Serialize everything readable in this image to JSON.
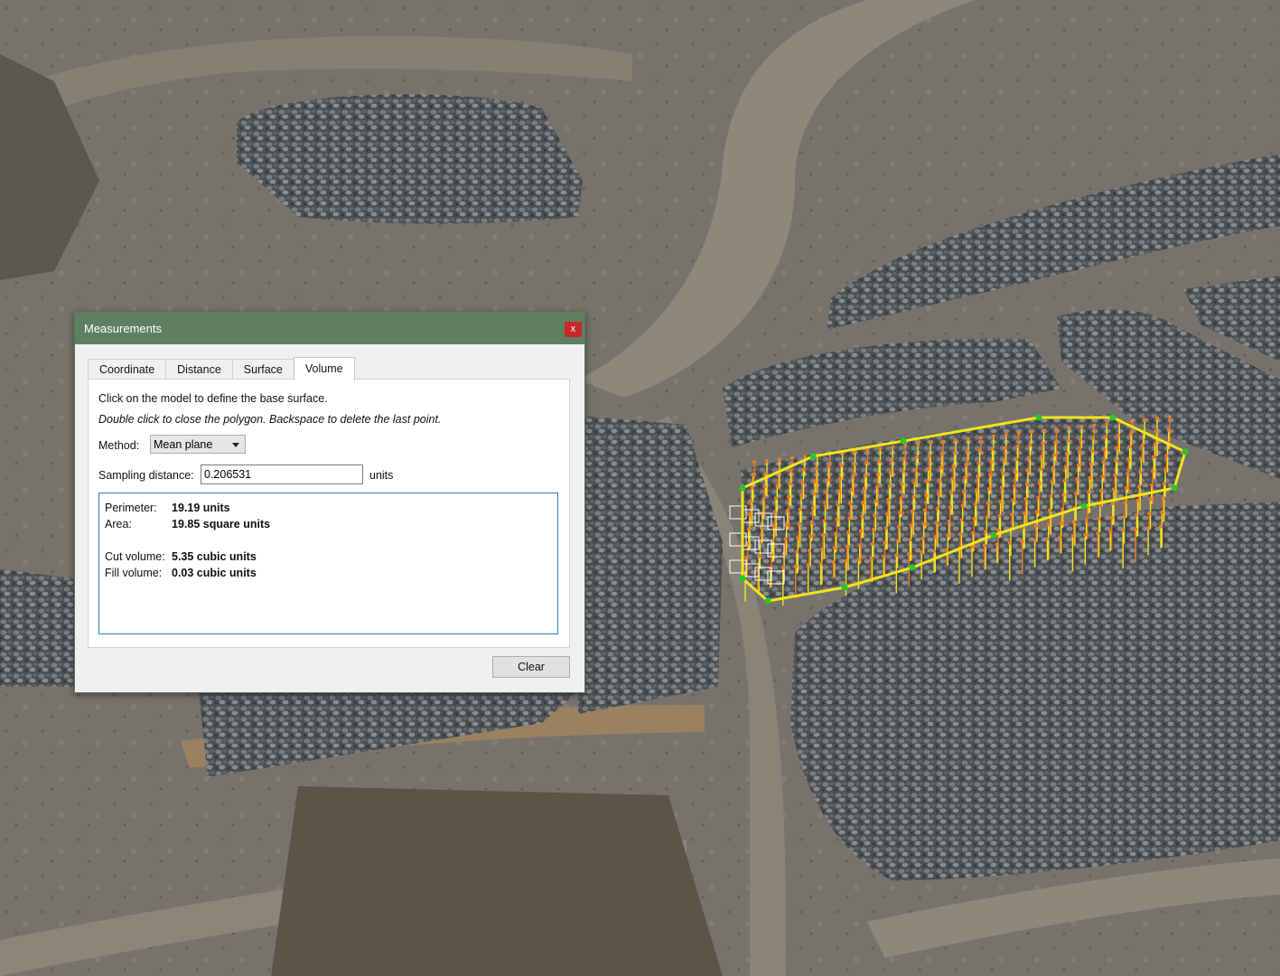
{
  "dialog": {
    "title": "Measurements",
    "close_glyph": "x",
    "tabs": [
      "Coordinate",
      "Distance",
      "Surface",
      "Volume"
    ],
    "active_tab": "Volume",
    "instruction": "Click on the model to define the base surface.",
    "hint": "Double click to close the polygon. Backspace to delete the last point.",
    "method_label": "Method:",
    "method_value": "Mean plane",
    "sampling_label": "Sampling distance:",
    "sampling_value": "0.206531",
    "sampling_unit": "units",
    "results": {
      "perimeter_label": "Perimeter:",
      "perimeter_value": "19.19 units",
      "area_label": "Area:",
      "area_value": "19.85 square units",
      "cut_label": "Cut volume:",
      "cut_value": "5.35 cubic units",
      "fill_label": "Fill volume:",
      "fill_value": "0.03 cubic units"
    },
    "clear_label": "Clear"
  },
  "colors": {
    "titlebar": "#5f8060",
    "close": "#c8282b",
    "polygon": "#f2e41c",
    "cut_points": "#f07a20",
    "vertices": "#28c828",
    "grid": "#ffffff"
  }
}
